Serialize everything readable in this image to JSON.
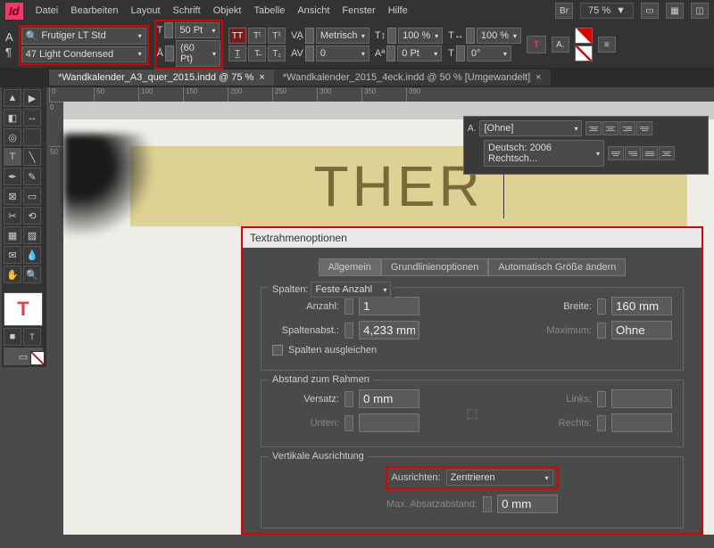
{
  "app": {
    "logo": "Id"
  },
  "menu": [
    "Datei",
    "Bearbeiten",
    "Layout",
    "Schrift",
    "Objekt",
    "Tabelle",
    "Ansicht",
    "Fenster",
    "Hilfe"
  ],
  "zoom": "75 %",
  "font": {
    "family": "Frutiger LT Std",
    "style": "47 Light Condensed",
    "size": "50 Pt",
    "leading": "(60 Pt)",
    "kerning": "Metrisch",
    "tracking": "0",
    "vscale": "100 %",
    "hscale": "100 %",
    "baseline": "0 Pt",
    "skew": "0°"
  },
  "tabs": [
    {
      "label": "*Wandkalender_A3_quer_2015.indd @ 75 %",
      "active": true
    },
    {
      "label": "*Wandkalender_2015_4eck.indd @ 50 % [Umgewandelt]",
      "active": false
    }
  ],
  "ruler_h": [
    "0",
    "50",
    "100",
    "150",
    "200",
    "250",
    "300",
    "350",
    "390"
  ],
  "ruler_v": [
    "0",
    "50"
  ],
  "canvas_text": "THER",
  "para_panel": {
    "label": "A.",
    "style": "[Ohne]",
    "lang": "Deutsch: 2006 Rechtsch..."
  },
  "dialog": {
    "title": "Textrahmenoptionen",
    "tabs": [
      "Allgemein",
      "Grundlinienoptionen",
      "Automatisch Größe ändern"
    ],
    "spalten": {
      "legend": "Spalten:",
      "type": "Feste Anzahl",
      "anzahl_label": "Anzahl:",
      "anzahl": "1",
      "breite_label": "Breite:",
      "breite": "160 mm",
      "abstand_label": "Spaltenabst.:",
      "abstand": "4,233 mm",
      "max_label": "Maximum:",
      "max": "Ohne",
      "balance": "Spalten ausgleichen"
    },
    "abstand": {
      "legend": "Abstand zum Rahmen",
      "versatz_label": "Versatz:",
      "versatz": "0 mm",
      "unten_label": "Unten:",
      "links_label": "Links:",
      "rechts_label": "Rechts:"
    },
    "vert": {
      "legend": "Vertikale Ausrichtung",
      "align_label": "Ausrichten:",
      "align": "Zentrieren",
      "max_label": "Max. Absatzabstand:",
      "max": "0 mm"
    }
  }
}
